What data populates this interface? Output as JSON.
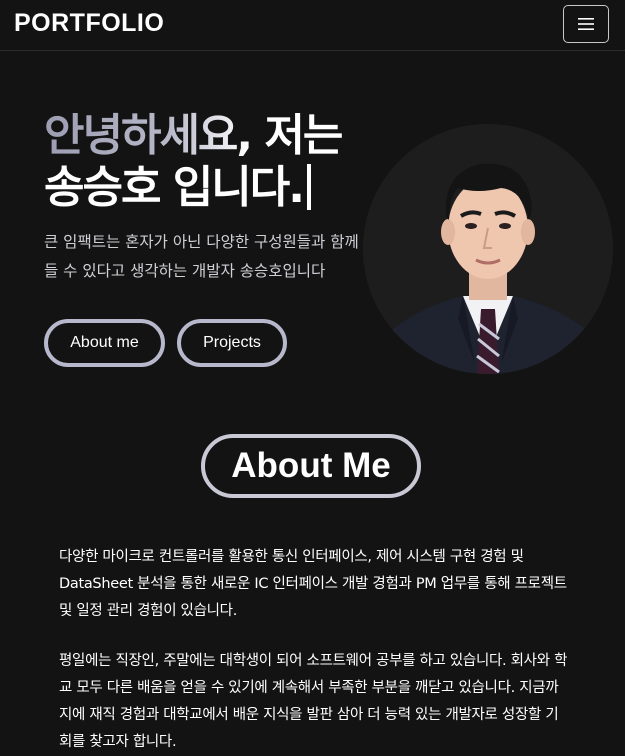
{
  "navbar": {
    "brand": "PORTFOLIO",
    "menu_icon": "hamburger-menu-icon"
  },
  "hero": {
    "greeting_highlight": "안녕하세요,",
    "greeting_rest": " 저는",
    "name_line": "송승호 입니다.",
    "description": "큰 임팩트는 혼자가 아닌 다양한 구성원들과 함께 만들 수 있다고 생각하는 개발자 송승호입니다",
    "buttons": {
      "about": "About me",
      "projects": "Projects"
    },
    "portrait_alt": "profile-photo"
  },
  "about": {
    "title": "About Me",
    "paragraphs": [
      "다양한 마이크로 컨트롤러를 활용한 통신 인터페이스, 제어 시스템 구현 경험 및 DataSheet 분석을 통한 새로운 IC 인터페이스 개발 경험과 PM 업무를 통해 프로젝트 및 일정 관리 경험이 있습니다.",
      "평일에는 직장인, 주말에는 대학생이 되어 소프트웨어 공부를 하고 있습니다. 회사와 학교 모두 다른 배움을 얻을 수 있기에 계속해서 부족한 부분을 깨닫고 있습니다. 지금까지에 재직 경험과 대학교에서 배운 지식을 발판 삼아 더 능력 있는 개발자로 성장할 기회를 찾고자 합니다."
    ]
  },
  "colors": {
    "background": "#141313",
    "accent_border": "#b8b8cc",
    "text": "#ffffff"
  }
}
